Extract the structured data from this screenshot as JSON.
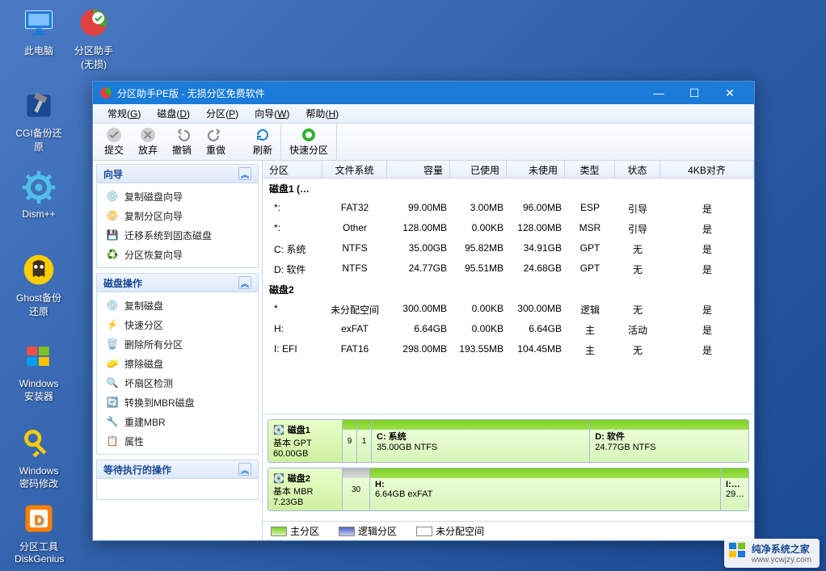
{
  "desktop": {
    "icons": [
      {
        "label": "此电脑"
      },
      {
        "label": "分区助手(无损)"
      },
      {
        "label": "CGI备份还原"
      },
      {
        "label": "Dism++"
      },
      {
        "label": "Ghost备份还原"
      },
      {
        "label": "Windows安装器"
      },
      {
        "label": "Windows密码修改"
      },
      {
        "label": "分区工具DiskGenius"
      }
    ]
  },
  "window": {
    "title": "分区助手PE版 - 无损分区免费软件"
  },
  "menu": {
    "items": [
      {
        "label": "常规",
        "key": "G"
      },
      {
        "label": "磁盘",
        "key": "D"
      },
      {
        "label": "分区",
        "key": "P"
      },
      {
        "label": "向导",
        "key": "W"
      },
      {
        "label": "帮助",
        "key": "H"
      }
    ]
  },
  "toolbar": {
    "submit": "提交",
    "discard": "放弃",
    "undo": "撤销",
    "redo": "重做",
    "refresh": "刷新",
    "quick": "快速分区"
  },
  "side": {
    "wizard": {
      "title": "向导",
      "items": [
        "复制磁盘向导",
        "复制分区向导",
        "迁移系统到固态磁盘",
        "分区恢复向导"
      ]
    },
    "diskops": {
      "title": "磁盘操作",
      "items": [
        "复制磁盘",
        "快速分区",
        "删除所有分区",
        "擦除磁盘",
        "坏扇区检测",
        "转换到MBR磁盘",
        "重建MBR",
        "属性"
      ]
    },
    "pending": {
      "title": "等待执行的操作"
    }
  },
  "grid": {
    "headers": [
      "分区",
      "文件系统",
      "容量",
      "已使用",
      "未使用",
      "类型",
      "状态",
      "4KB对齐"
    ],
    "disk1": {
      "title": "磁盘1 (…"
    },
    "disk1rows": [
      {
        "part": "*:",
        "fs": "FAT32",
        "cap": "99.00MB",
        "used": "3.00MB",
        "free": "96.00MB",
        "type": "ESP",
        "stat": "引导",
        "align": "是"
      },
      {
        "part": "*:",
        "fs": "Other",
        "cap": "128.00MB",
        "used": "0.00KB",
        "free": "128.00MB",
        "type": "MSR",
        "stat": "引导",
        "align": "是"
      },
      {
        "part": "C: 系统",
        "fs": "NTFS",
        "cap": "35.00GB",
        "used": "95.82MB",
        "free": "34.91GB",
        "type": "GPT",
        "stat": "无",
        "align": "是"
      },
      {
        "part": "D: 软件",
        "fs": "NTFS",
        "cap": "24.77GB",
        "used": "95.51MB",
        "free": "24.68GB",
        "type": "GPT",
        "stat": "无",
        "align": "是"
      }
    ],
    "disk2": {
      "title": "磁盘2"
    },
    "disk2rows": [
      {
        "part": "*",
        "fs": "未分配空间",
        "cap": "300.00MB",
        "used": "0.00KB",
        "free": "300.00MB",
        "type": "逻辑",
        "stat": "无",
        "align": "是"
      },
      {
        "part": "H:",
        "fs": "exFAT",
        "cap": "6.64GB",
        "used": "0.00KB",
        "free": "6.64GB",
        "type": "主",
        "stat": "活动",
        "align": "是"
      },
      {
        "part": "I: EFI",
        "fs": "FAT16",
        "cap": "298.00MB",
        "used": "193.55MB",
        "free": "104.45MB",
        "type": "主",
        "stat": "无",
        "align": "是"
      }
    ]
  },
  "bars": {
    "d1": {
      "name": "磁盘1",
      "sub": "基本 GPT",
      "size": "60.00GB",
      "p1": "9",
      "p2": "1",
      "seg1": {
        "t": "C: 系统",
        "s": "35.00GB NTFS"
      },
      "seg2": {
        "t": "D: 软件",
        "s": "24.77GB NTFS"
      }
    },
    "d2": {
      "name": "磁盘2",
      "sub": "基本 MBR",
      "size": "7.23GB",
      "p1": "30",
      "seg1": {
        "t": "H:",
        "s": "6.64GB exFAT"
      },
      "seg2": {
        "t": "I:…",
        "s": "29…"
      }
    }
  },
  "legend": {
    "main": "主分区",
    "logic": "逻辑分区",
    "free": "未分配空间"
  },
  "watermark": {
    "line1": "纯净系统之家",
    "line2": "www.ycwjzy.com"
  }
}
